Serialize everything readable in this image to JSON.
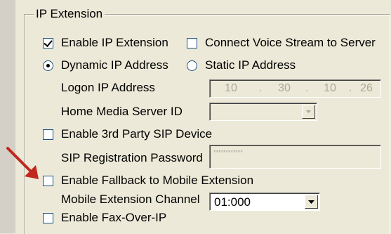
{
  "group": {
    "title": "IP Extension"
  },
  "enable_ip_extension": {
    "label": "Enable IP Extension",
    "checked": true
  },
  "connect_voice_stream": {
    "label": "Connect Voice Stream to Server",
    "checked": false
  },
  "dynamic_ip": {
    "label": "Dynamic IP Address",
    "selected": true
  },
  "static_ip": {
    "label": "Static IP Address",
    "selected": false
  },
  "logon_ip": {
    "label": "Logon IP Address",
    "octets": [
      "10",
      "30",
      "10",
      "26"
    ],
    "separator": "."
  },
  "home_media_server": {
    "label": "Home Media Server ID",
    "value": ""
  },
  "enable_3rd_party_sip": {
    "label": "Enable 3rd Party SIP Device",
    "checked": false
  },
  "sip_password": {
    "label": "SIP Registration Password",
    "value": "************"
  },
  "enable_fallback": {
    "label": "Enable Fallback to Mobile Extension",
    "checked": false
  },
  "mobile_channel": {
    "label": "Mobile Extension Channel",
    "value": "01:000"
  },
  "enable_fax_over_ip": {
    "label": "Enable Fax-Over-IP",
    "checked": false
  },
  "colors": {
    "panel": "#ece9d8",
    "arrow": "#c0271d",
    "disabled_text": "#aca899",
    "control_border": "#1c5180"
  }
}
